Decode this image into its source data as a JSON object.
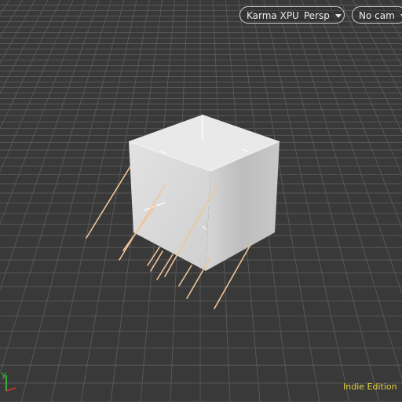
{
  "viewport": {
    "renderer_label": "Karma XPU",
    "view_label": "Persp",
    "camera_label": "No cam",
    "edition_label": "Indie Edition"
  },
  "axis_gizmo": {
    "y_label": "y"
  },
  "icons": [
    "chevron-down-icon",
    "axis-gizmo-icon"
  ],
  "colors": {
    "background": "#393939",
    "grid": "#575757",
    "cube": "#dcdcdc",
    "strands": "#f0c49a",
    "edition_text": "#e8d33a",
    "axis_y": "#3cd23c",
    "axis_x": "#dc3232"
  }
}
